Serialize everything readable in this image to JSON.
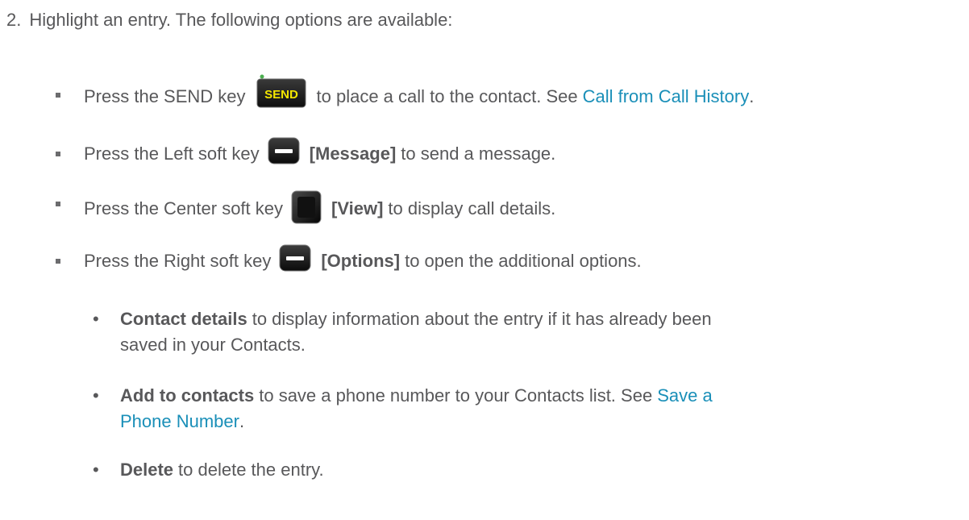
{
  "step": {
    "number": "2.",
    "text": "Highlight an entry. The following options are available:"
  },
  "bullets": [
    {
      "before": "Press the SEND key",
      "key_icon": "send-key-icon",
      "key_label": "SEND",
      "after": "to place a call to the contact. See",
      "link": "Call from Call History",
      "end": "."
    },
    {
      "before": "Press the Left soft key",
      "key_icon": "left-soft-key-icon",
      "bracket": "[Message]",
      "after": "to send a message."
    },
    {
      "before": "Press the Center soft key",
      "key_icon": "center-soft-key-icon",
      "bracket": "[View]",
      "after": "to display call details."
    },
    {
      "before": "Press the Right soft key",
      "key_icon": "right-soft-key-icon",
      "bracket": "[Options]",
      "after": "to open the additional options."
    }
  ],
  "sub_options": [
    {
      "bullet": "•",
      "bold": "Contact details",
      "line1": "to display information about the entry if it has already been",
      "line2": "saved in your Contacts."
    },
    {
      "bullet": "•",
      "bold": "Add to contacts",
      "line1": "to save a phone number to your Contacts list. See",
      "link1": "Save a",
      "link2": "Phone Number",
      "end": "."
    },
    {
      "bullet": "•",
      "bold": "Delete",
      "line1": "to delete the entry."
    }
  ],
  "colors": {
    "text": "#58585a",
    "link": "#1a8fb8",
    "send_key_text": "#f3e600",
    "key_body": "#1b1b1b"
  }
}
